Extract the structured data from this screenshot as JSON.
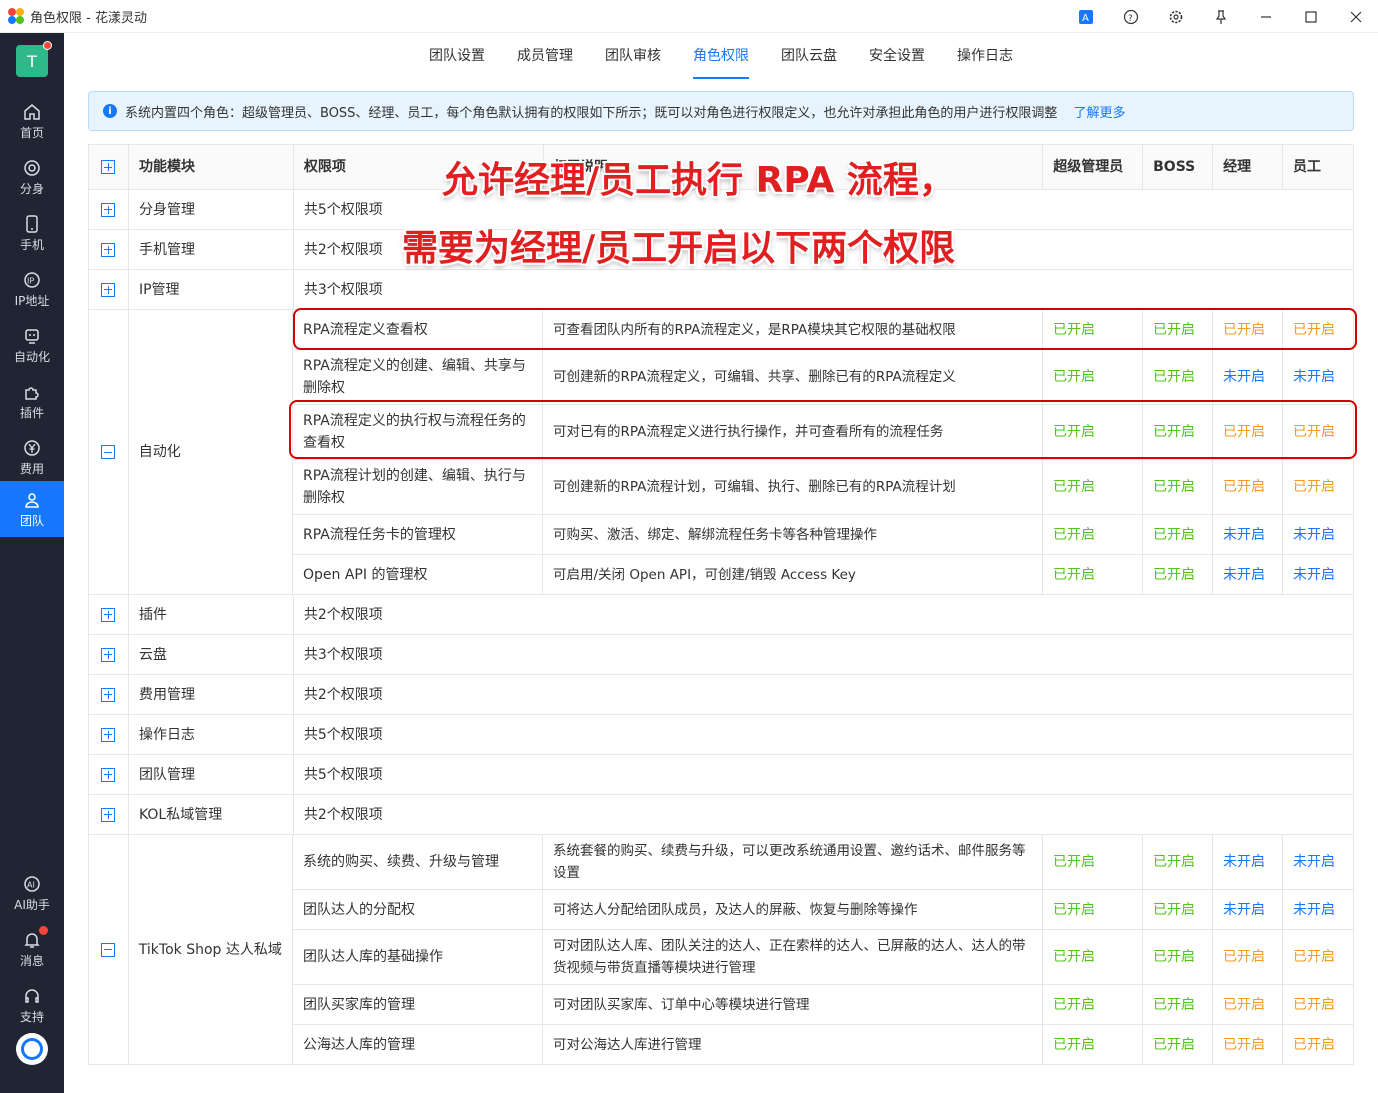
{
  "window": {
    "title": "角色权限 - 花漾灵动"
  },
  "avatar": {
    "letter": "T"
  },
  "sidebar": {
    "items": [
      {
        "label": "首页",
        "icon": "home-icon"
      },
      {
        "label": "分身",
        "icon": "browser-icon"
      },
      {
        "label": "手机",
        "icon": "phone-icon"
      },
      {
        "label": "IP地址",
        "icon": "ip-icon"
      },
      {
        "label": "自动化",
        "icon": "robot-icon"
      },
      {
        "label": "插件",
        "icon": "puzzle-icon"
      },
      {
        "label": "费用",
        "icon": "yen-icon"
      },
      {
        "label": "团队",
        "icon": "team-icon"
      }
    ],
    "bottom": [
      {
        "label": "AI助手",
        "icon": "ai-icon"
      },
      {
        "label": "消息",
        "icon": "bell-icon"
      },
      {
        "label": "支持",
        "icon": "headset-icon"
      }
    ]
  },
  "tabs": [
    "团队设置",
    "成员管理",
    "团队审核",
    "角色权限",
    "团队云盘",
    "安全设置",
    "操作日志"
  ],
  "active_tab": "角色权限",
  "info": {
    "text": "系统内置四个角色：超级管理员、BOSS、经理、员工，每个角色默认拥有的权限如下所示；既可以对角色进行权限定义，也允许对承担此角色的用户进行权限调整",
    "link": "了解更多"
  },
  "table": {
    "headers": [
      "功能模块",
      "权限项",
      "权限说明",
      "超级管理员",
      "BOSS",
      "经理",
      "员工"
    ],
    "collapsed": [
      {
        "module": "分身管理",
        "summary": "共5个权限项"
      },
      {
        "module": "手机管理",
        "summary": "共2个权限项"
      },
      {
        "module": "IP管理",
        "summary": "共3个权限项"
      }
    ],
    "automation": {
      "module": "自动化",
      "rows": [
        {
          "perm": "RPA流程定义查看权",
          "desc": "可查看团队内所有的RPA流程定义，是RPA模块其它权限的基础权限",
          "r": [
            "已开启",
            "已开启",
            "已开启",
            "已开启"
          ]
        },
        {
          "perm": "RPA流程定义的创建、编辑、共享与删除权",
          "desc": "可创建新的RPA流程定义，可编辑、共享、删除已有的RPA流程定义",
          "r": [
            "已开启",
            "已开启",
            "未开启",
            "未开启"
          ]
        },
        {
          "perm": "RPA流程定义的执行权与流程任务的查看权",
          "desc": "可对已有的RPA流程定义进行执行操作，并可查看所有的流程任务",
          "r": [
            "已开启",
            "已开启",
            "已开启",
            "已开启"
          ]
        },
        {
          "perm": "RPA流程计划的创建、编辑、执行与删除权",
          "desc": "可创建新的RPA流程计划，可编辑、执行、删除已有的RPA流程计划",
          "r": [
            "已开启",
            "已开启",
            "已开启",
            "已开启"
          ]
        },
        {
          "perm": "RPA流程任务卡的管理权",
          "desc": "可购买、激活、绑定、解绑流程任务卡等各种管理操作",
          "r": [
            "已开启",
            "已开启",
            "未开启",
            "未开启"
          ]
        },
        {
          "perm": "Open API 的管理权",
          "desc": "可启用/关闭 Open API，可创建/销毁 Access Key",
          "r": [
            "已开启",
            "已开启",
            "未开启",
            "未开启"
          ]
        }
      ]
    },
    "collapsed2": [
      {
        "module": "插件",
        "summary": "共2个权限项"
      },
      {
        "module": "云盘",
        "summary": "共3个权限项"
      },
      {
        "module": "费用管理",
        "summary": "共2个权限项"
      },
      {
        "module": "操作日志",
        "summary": "共5个权限项"
      },
      {
        "module": "团队管理",
        "summary": "共5个权限项"
      },
      {
        "module": "KOL私域管理",
        "summary": "共2个权限项"
      }
    ],
    "tiktok": {
      "module": "TikTok Shop 达人私域",
      "rows": [
        {
          "perm": "系统的购买、续费、升级与管理",
          "desc": "系统套餐的购买、续费与升级，可以更改系统通用设置、邀约话术、邮件服务等设置",
          "r": [
            "已开启",
            "已开启",
            "未开启",
            "未开启"
          ]
        },
        {
          "perm": "团队达人的分配权",
          "desc": "可将达人分配给团队成员，及达人的屏蔽、恢复与删除等操作",
          "r": [
            "已开启",
            "已开启",
            "未开启",
            "未开启"
          ]
        },
        {
          "perm": "团队达人库的基础操作",
          "desc": "可对团队达人库、团队关注的达人、正在索样的达人、已屏蔽的达人、达人的带货视频与带货直播等模块进行管理",
          "r": [
            "已开启",
            "已开启",
            "已开启",
            "已开启"
          ]
        },
        {
          "perm": "团队买家库的管理",
          "desc": "可对团队买家库、订单中心等模块进行管理",
          "r": [
            "已开启",
            "已开启",
            "已开启",
            "已开启"
          ]
        },
        {
          "perm": "公海达人库的管理",
          "desc": "可对公海达人库进行管理",
          "r": [
            "已开启",
            "已开启",
            "已开启",
            "已开启"
          ]
        }
      ]
    }
  },
  "overlay": {
    "line1": "允许经理/员工执行 RPA 流程，",
    "line2": "需要为经理/员工开启以下两个权限"
  },
  "colors": {
    "on_green": "#52c41a",
    "on_orange": "#f59a23",
    "off_blue": "#1677ff",
    "accent": "#1677ff"
  }
}
